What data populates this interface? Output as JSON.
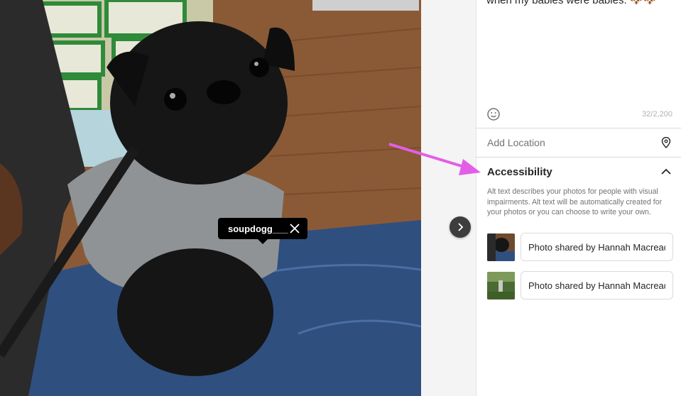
{
  "photo": {
    "tag_label": "soupdogg___"
  },
  "post": {
    "caption": "when my babies were babies. 🐶🐶",
    "char_count": "32/2,200"
  },
  "location": {
    "placeholder": "Add Location"
  },
  "accessibility": {
    "title": "Accessibility",
    "description": "Alt text describes your photos for people with visual impairments. Alt text will be automatically created for your photos or you can choose to write your own.",
    "alt_inputs": [
      {
        "value": "Photo shared by Hannah Macready"
      },
      {
        "value": "Photo shared by Hannah Macready"
      }
    ]
  },
  "colors": {
    "annotation_arrow": "#e35ee8",
    "tag_bg": "#000000",
    "nav_button": "#3d3d3d"
  }
}
